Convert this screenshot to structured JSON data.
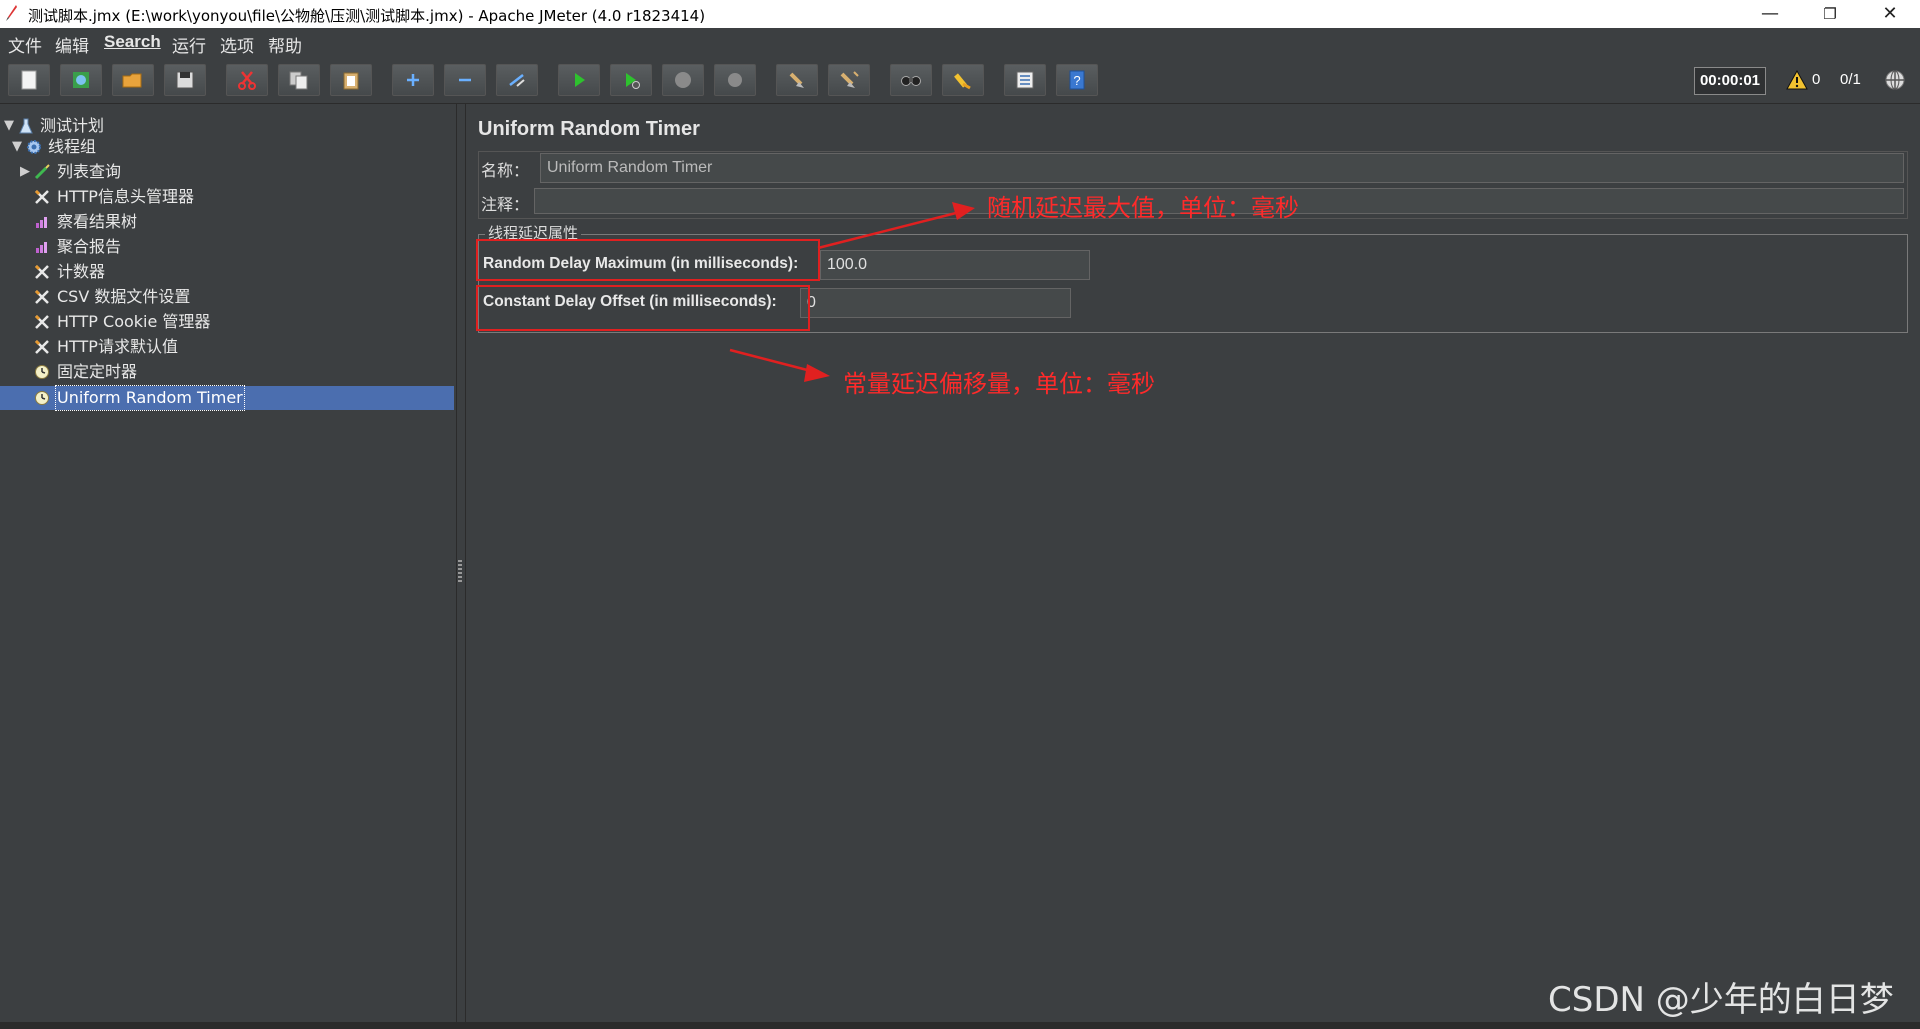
{
  "window": {
    "title": "测试脚本.jmx (E:\\work\\yonyou\\file\\公物舱\\压测\\测试脚本.jmx) - Apache JMeter (4.0 r1823414)",
    "minimize": "—",
    "restore": "❐",
    "close": "✕"
  },
  "menu": {
    "items": [
      "文件",
      "编辑",
      "Search",
      "运行",
      "选项",
      "帮助"
    ]
  },
  "toolbar": {
    "buttons": [
      {
        "name": "new-icon"
      },
      {
        "name": "templates-icon"
      },
      {
        "name": "open-icon"
      },
      {
        "name": "save-icon"
      },
      {
        "name": "cut-icon"
      },
      {
        "name": "copy-icon"
      },
      {
        "name": "paste-icon"
      },
      {
        "name": "expand-icon"
      },
      {
        "name": "collapse-icon"
      },
      {
        "name": "toggle-icon"
      },
      {
        "name": "start-icon"
      },
      {
        "name": "start-no-pause-icon"
      },
      {
        "name": "stop-icon"
      },
      {
        "name": "shutdown-icon"
      },
      {
        "name": "clear-icon"
      },
      {
        "name": "clear-all-icon"
      },
      {
        "name": "search-icon"
      },
      {
        "name": "reset-search-icon"
      },
      {
        "name": "function-helper-icon"
      },
      {
        "name": "help-icon"
      }
    ],
    "elapsed_time": "00:00:01",
    "warning_count": "0",
    "active_threads": "0/1"
  },
  "tree": {
    "items": [
      {
        "label": "测试计划",
        "icon": "test-plan-icon",
        "arrow": "▼"
      },
      {
        "label": "线程组",
        "icon": "thread-group-icon",
        "arrow": "▼"
      },
      {
        "label": "列表查询",
        "icon": "sampler-icon",
        "arrow": "▶"
      },
      {
        "label": "HTTP信息头管理器",
        "icon": "config-icon",
        "arrow": ""
      },
      {
        "label": "察看结果树",
        "icon": "listener-icon",
        "arrow": ""
      },
      {
        "label": "聚合报告",
        "icon": "listener-icon",
        "arrow": ""
      },
      {
        "label": "计数器",
        "icon": "config-icon",
        "arrow": ""
      },
      {
        "label": "CSV 数据文件设置",
        "icon": "config-icon",
        "arrow": ""
      },
      {
        "label": "HTTP Cookie 管理器",
        "icon": "config-icon",
        "arrow": ""
      },
      {
        "label": "HTTP请求默认值",
        "icon": "config-icon",
        "arrow": ""
      },
      {
        "label": "固定定时器",
        "icon": "timer-icon",
        "arrow": ""
      },
      {
        "label": "Uniform Random Timer",
        "icon": "timer-icon",
        "arrow": ""
      }
    ]
  },
  "panel": {
    "title": "Uniform Random Timer",
    "name_label": "名称：",
    "name_value": "Uniform Random Timer",
    "comment_label": "注释：",
    "comment_value": "",
    "group_title": "线程延迟属性",
    "random_delay_label": "Random Delay Maximum (in milliseconds):",
    "random_delay_value": "100.0",
    "constant_delay_label": "Constant Delay Offset (in milliseconds):",
    "constant_delay_value": "0"
  },
  "annotations": {
    "random_note": "随机延迟最大值，单位：毫秒",
    "constant_note": "常量延迟偏移量，单位：毫秒",
    "color": "#ff2a2a"
  },
  "watermark": "CSDN @少年的白日梦"
}
